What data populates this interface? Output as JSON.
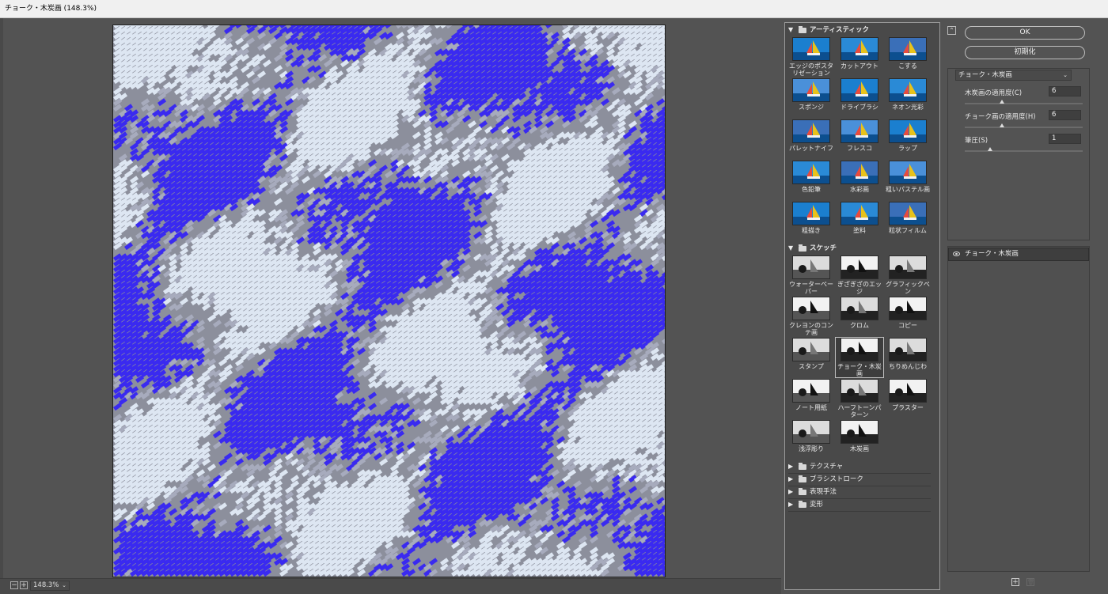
{
  "window": {
    "title": "チョーク・木炭画 (148.3%)"
  },
  "preview": {
    "zoom": "148.3%",
    "colors": {
      "blue": "#3a2af0",
      "light": "#dde6f2",
      "gray": "#8c8f9c"
    }
  },
  "gallery": {
    "categories": [
      {
        "label": "アーティスティック",
        "expanded": true,
        "items": [
          {
            "label": "エッジのポスタリゼーション",
            "icon": "sailboat-thumbnail"
          },
          {
            "label": "カットアウト",
            "icon": "sailboat-thumbnail"
          },
          {
            "label": "こする",
            "icon": "sailboat-thumbnail"
          },
          {
            "label": "スポンジ",
            "icon": "sailboat-thumbnail"
          },
          {
            "label": "ドライブラシ",
            "icon": "sailboat-thumbnail"
          },
          {
            "label": "ネオン光彩",
            "icon": "sailboat-thumbnail"
          },
          {
            "label": "パレットナイフ",
            "icon": "sailboat-thumbnail"
          },
          {
            "label": "フレスコ",
            "icon": "sailboat-thumbnail"
          },
          {
            "label": "ラップ",
            "icon": "sailboat-thumbnail"
          },
          {
            "label": "色鉛筆",
            "icon": "sailboat-thumbnail"
          },
          {
            "label": "水彩画",
            "icon": "sailboat-thumbnail"
          },
          {
            "label": "粗いパステル画",
            "icon": "sailboat-thumbnail"
          },
          {
            "label": "粗描き",
            "icon": "sailboat-thumbnail"
          },
          {
            "label": "塗料",
            "icon": "sailboat-thumbnail"
          },
          {
            "label": "粒状フィルム",
            "icon": "sailboat-thumbnail"
          }
        ]
      },
      {
        "label": "スケッチ",
        "expanded": true,
        "items": [
          {
            "label": "ウォーターペーパー",
            "icon": "sailboat-thumbnail"
          },
          {
            "label": "ぎざぎざのエッジ",
            "icon": "sailboat-thumbnail"
          },
          {
            "label": "グラフィックペン",
            "icon": "sailboat-thumbnail"
          },
          {
            "label": "クレヨンのコンテ画",
            "icon": "sailboat-thumbnail"
          },
          {
            "label": "クロム",
            "icon": "sailboat-thumbnail"
          },
          {
            "label": "コピー",
            "icon": "sailboat-thumbnail"
          },
          {
            "label": "スタンプ",
            "icon": "sailboat-thumbnail"
          },
          {
            "label": "チョーク・木炭画",
            "icon": "sailboat-thumbnail",
            "selected": true
          },
          {
            "label": "ちりめんじわ",
            "icon": "sailboat-thumbnail"
          },
          {
            "label": "ノート用紙",
            "icon": "sailboat-thumbnail"
          },
          {
            "label": "ハーフトーンパターン",
            "icon": "sailboat-thumbnail"
          },
          {
            "label": "プラスター",
            "icon": "sailboat-thumbnail"
          },
          {
            "label": "浅浮彫り",
            "icon": "sailboat-thumbnail"
          },
          {
            "label": "木炭画",
            "icon": "sailboat-thumbnail"
          }
        ]
      },
      {
        "label": "テクスチャ",
        "expanded": false
      },
      {
        "label": "ブラシストローク",
        "expanded": false
      },
      {
        "label": "表現手法",
        "expanded": false
      },
      {
        "label": "変形",
        "expanded": false
      }
    ]
  },
  "settings": {
    "ok_label": "OK",
    "reset_label": "初期化",
    "selected_filter": "チョーク・木炭画",
    "params": [
      {
        "label": "木炭画の適用度(C)",
        "value": "6",
        "fraction": 0.3
      },
      {
        "label": "チョーク画の適用度(H)",
        "value": "6",
        "fraction": 0.3
      },
      {
        "label": "筆圧(S)",
        "value": "1",
        "fraction": 0.2
      }
    ]
  },
  "layers": {
    "items": [
      {
        "label": "チョーク・木炭画",
        "visible": true
      }
    ],
    "new_layer_label": "+",
    "delete_label": "🗑"
  }
}
